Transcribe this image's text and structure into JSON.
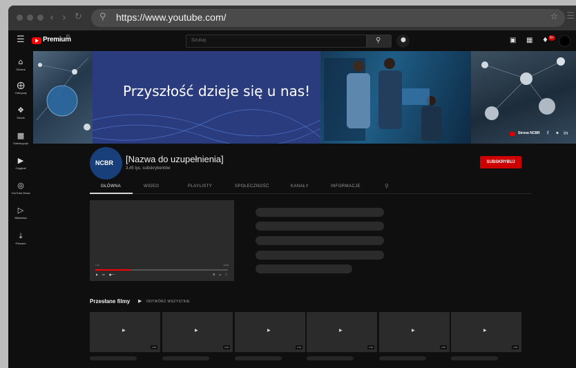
{
  "browser": {
    "url": "https://www.youtube.com/",
    "search_icon": "search-icon",
    "bookmark_icon": "star-icon"
  },
  "masthead": {
    "logo_text": "Premium",
    "logo_superscript": "PL",
    "search_placeholder": "Szukaj",
    "notification_count": "9+",
    "brand_color": "#ff0000"
  },
  "sidebar": {
    "items": [
      {
        "label": "Główna",
        "icon": "home-icon"
      },
      {
        "label": "Odkrywaj",
        "icon": "compass-icon"
      },
      {
        "label": "Shorts",
        "icon": "shorts-icon"
      },
      {
        "label": "Subskrypcje",
        "icon": "subscriptions-icon"
      },
      {
        "label": "Oryginał",
        "icon": "originals-icon"
      },
      {
        "label": "YouTube Music",
        "icon": "music-icon"
      },
      {
        "label": "Biblioteka",
        "icon": "library-icon"
      },
      {
        "label": "Pobrane",
        "icon": "download-icon"
      }
    ]
  },
  "banner": {
    "headline": "Przyszłość dzieje się u nas!",
    "social_label": "Strona NCBR"
  },
  "channel": {
    "logo_text": "NCBR",
    "name": "[Nazwa do uzupełnienia]",
    "subscribers": "3,45 tys. subskrybentów",
    "subscribe_label": "SUBSKRYBUJ",
    "subscribe_color": "#cc0000"
  },
  "tabs": [
    {
      "label": "GŁÓWNA",
      "active": true
    },
    {
      "label": "WIDEO",
      "active": false
    },
    {
      "label": "PLAYLISTY",
      "active": false
    },
    {
      "label": "SPOŁECZNOŚĆ",
      "active": false
    },
    {
      "label": "KANAŁY",
      "active": false
    },
    {
      "label": "INFORMACJE",
      "active": false
    }
  ],
  "player": {
    "time_current": "1:23",
    "time_total": "10:00",
    "progress": 0.27
  },
  "uploads": {
    "title": "Przesłane filmy",
    "play_all": "ODTWÓRZ WSZYSTKIE",
    "video_durations": [
      "2:30",
      "2:30",
      "2:30",
      "2:30",
      "2:30",
      "2:30"
    ]
  }
}
